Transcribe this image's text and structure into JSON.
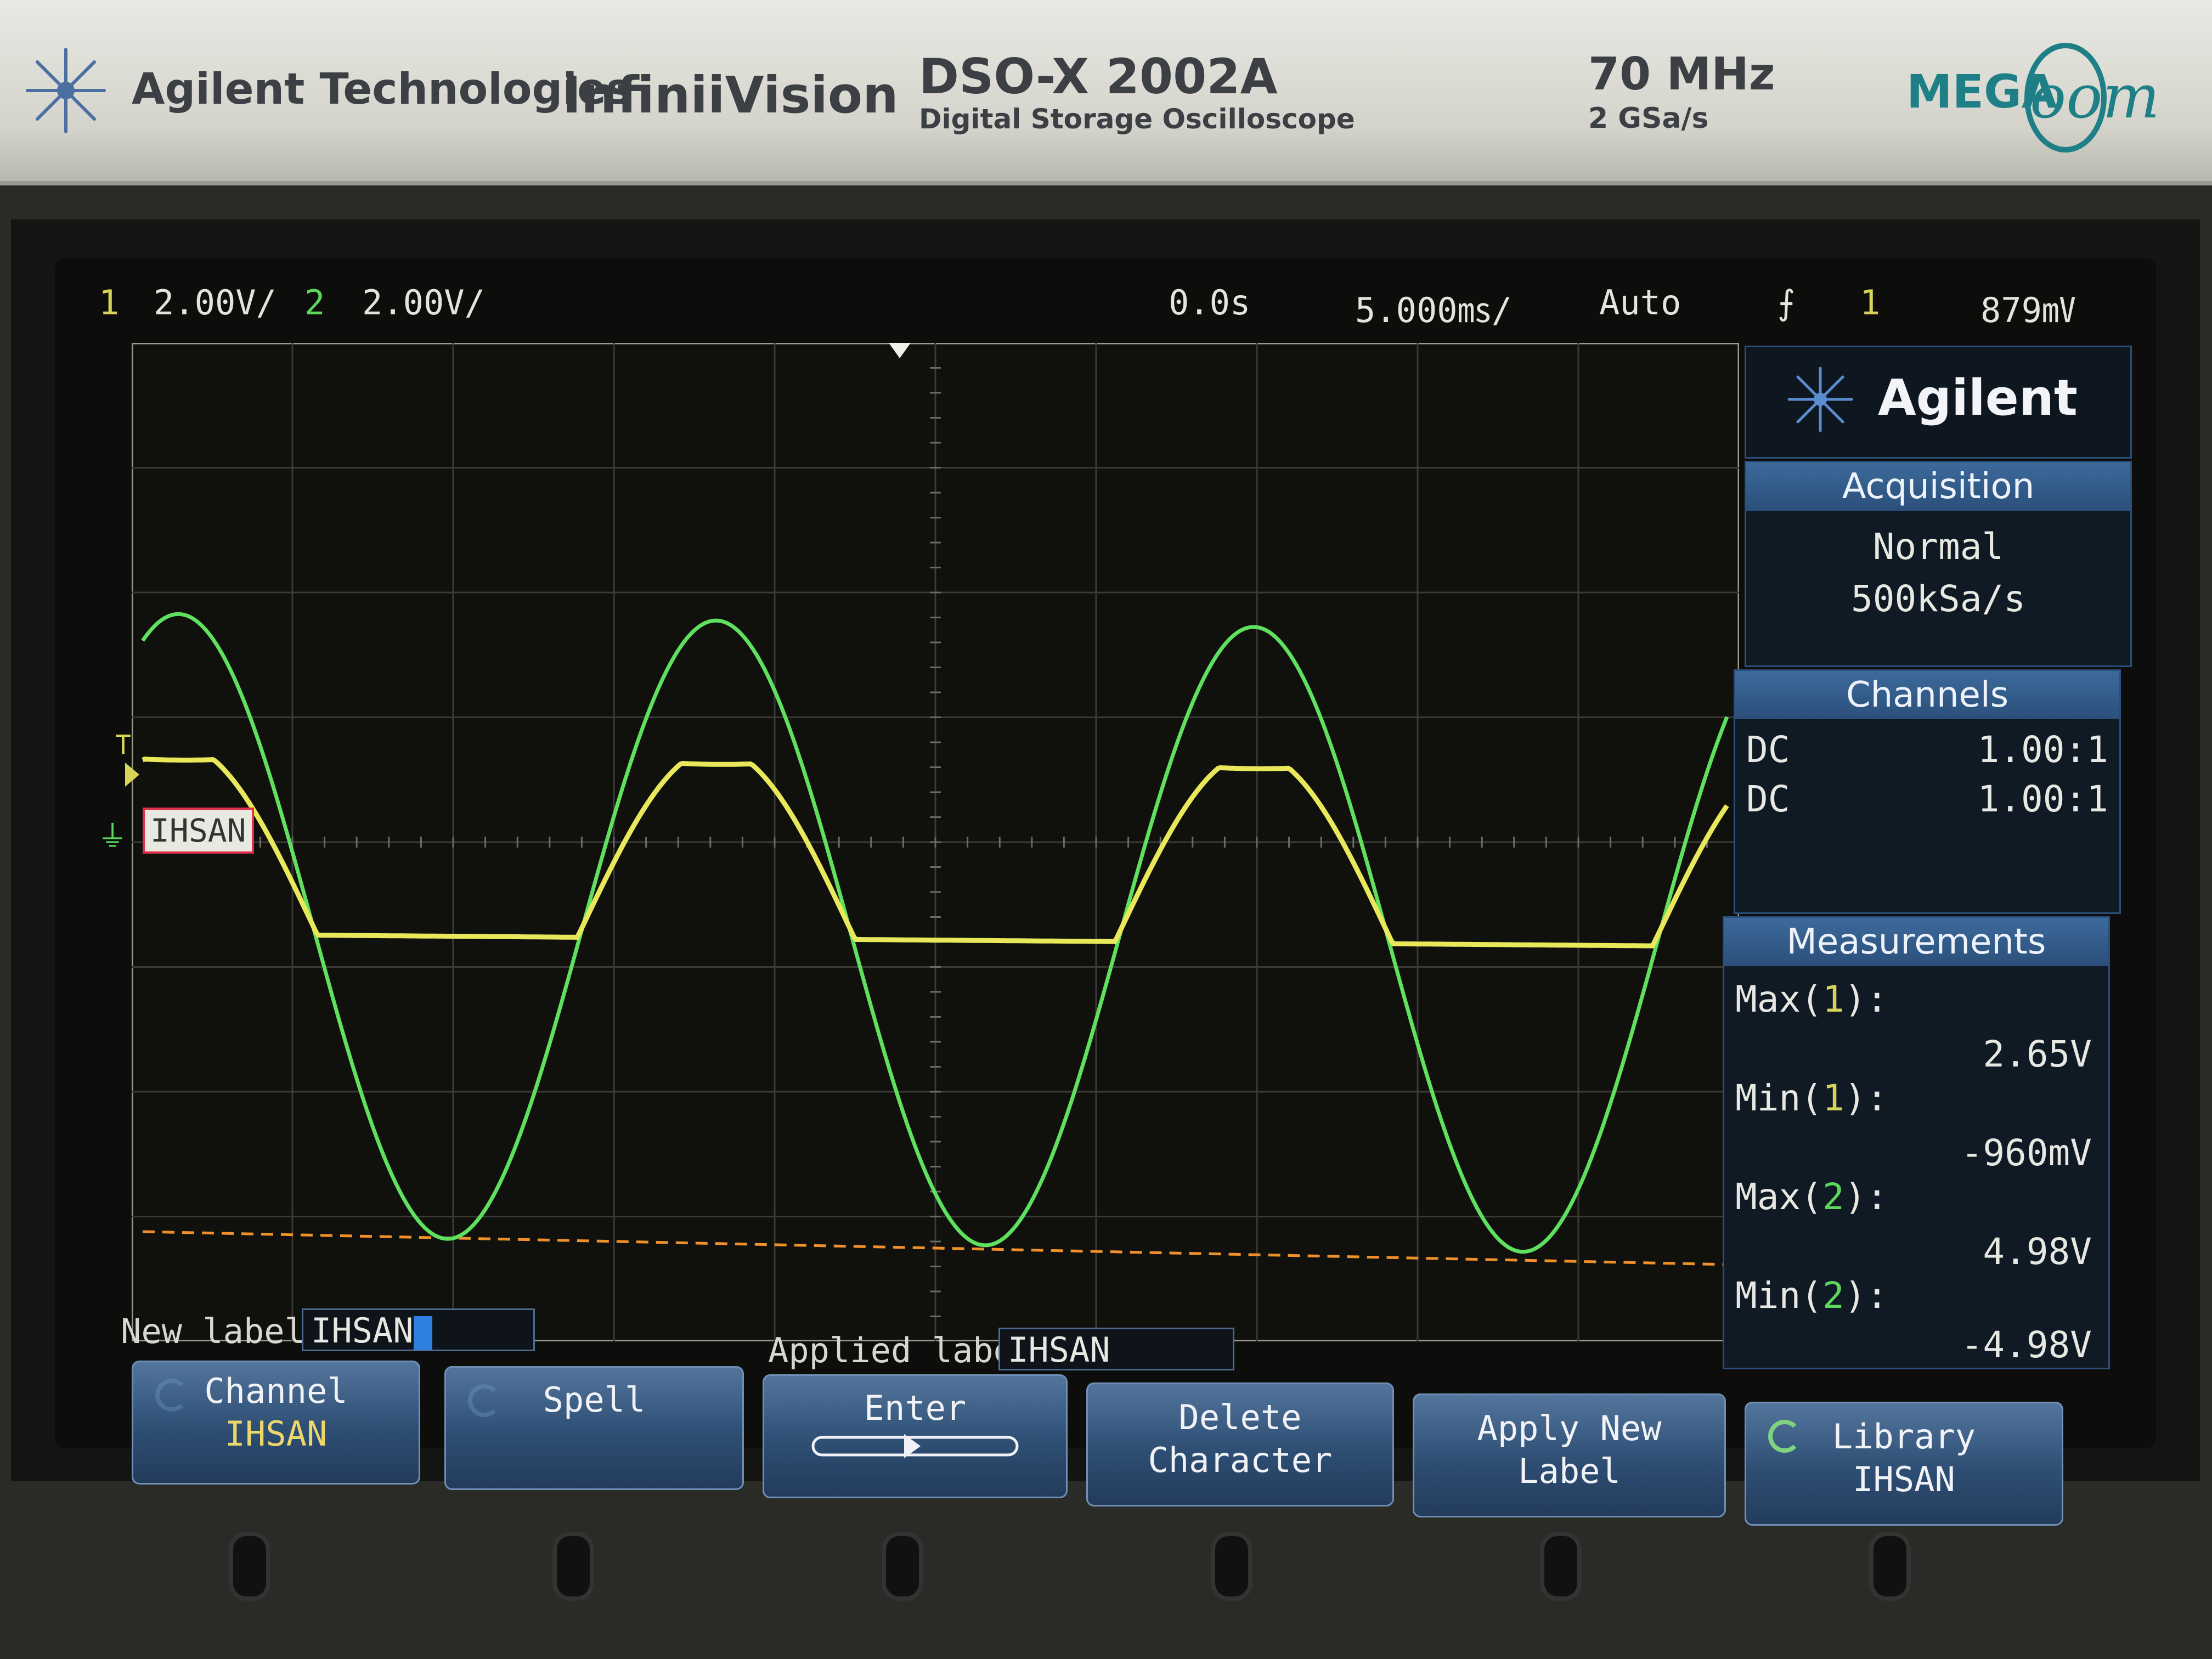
{
  "header": {
    "brand": "Agilent Technologies",
    "series": "InfiniiVision",
    "model": "DSO-X 2002A",
    "model_desc": "Digital Storage Oscilloscope",
    "bandwidth": "70 MHz",
    "sample_rate": "2 GSa/s",
    "megazoom_prefix": "MEGA",
    "megazoom_suffix": "oom"
  },
  "status_bar": {
    "ch1_num": "1",
    "ch1_scale": "2.00V/",
    "ch2_num": "2",
    "ch2_scale": "2.00V/",
    "time_delay": "0.0s",
    "time_scale": "5.000㎳/",
    "trigger_mode": "Auto",
    "trigger_edge": "⨍",
    "trigger_source": "1",
    "trigger_level": "879㎷"
  },
  "colors": {
    "ch1": "#e8e85a",
    "ch2": "#5fe05f",
    "trigger_line": "#f0902a",
    "panel_header": "#3c6a9c"
  },
  "waveforms": {
    "ch1_label": "IHSAN",
    "ch2_marker": "T",
    "measured_ch1_max_v": 2.65,
    "measured_ch1_min_v": -0.96,
    "measured_ch2_max_v": 4.98,
    "measured_ch2_min_v": -4.98
  },
  "panel": {
    "logo": "Agilent",
    "acquisition": {
      "title": "Acquisition",
      "mode": "Normal",
      "rate": "500kSa/s"
    },
    "channels": {
      "title": "Channels",
      "rows": [
        {
          "coupling": "DC",
          "ratio": "1.00:1"
        },
        {
          "coupling": "DC",
          "ratio": "1.00:1"
        }
      ]
    },
    "measurements": {
      "title": "Measurements",
      "items": [
        {
          "name": "Max(",
          "ch": "1",
          "close": "):",
          "value": "2.65V"
        },
        {
          "name": "Min(",
          "ch": "1",
          "close": "):",
          "value": "-960mV"
        },
        {
          "name": "Max(",
          "ch": "2",
          "close": "):",
          "value": "4.98V"
        },
        {
          "name": "Min(",
          "ch": "2",
          "close": "):",
          "value": "-4.98V"
        }
      ]
    }
  },
  "label_row": {
    "new_label_caption": "New label =",
    "new_label_value": "IHSAN",
    "applied_label_caption": "Applied label =",
    "applied_label_value": "IHSAN"
  },
  "softkeys": [
    {
      "line1": "Channel",
      "line2": "IHSAN"
    },
    {
      "line1": "Spell",
      "line2": ""
    },
    {
      "line1": "Enter",
      "line2": ""
    },
    {
      "line1": "Delete",
      "line2": "Character"
    },
    {
      "line1": "Apply New",
      "line2": "Label"
    },
    {
      "line1": "Library",
      "line2": "IHSAN"
    }
  ]
}
